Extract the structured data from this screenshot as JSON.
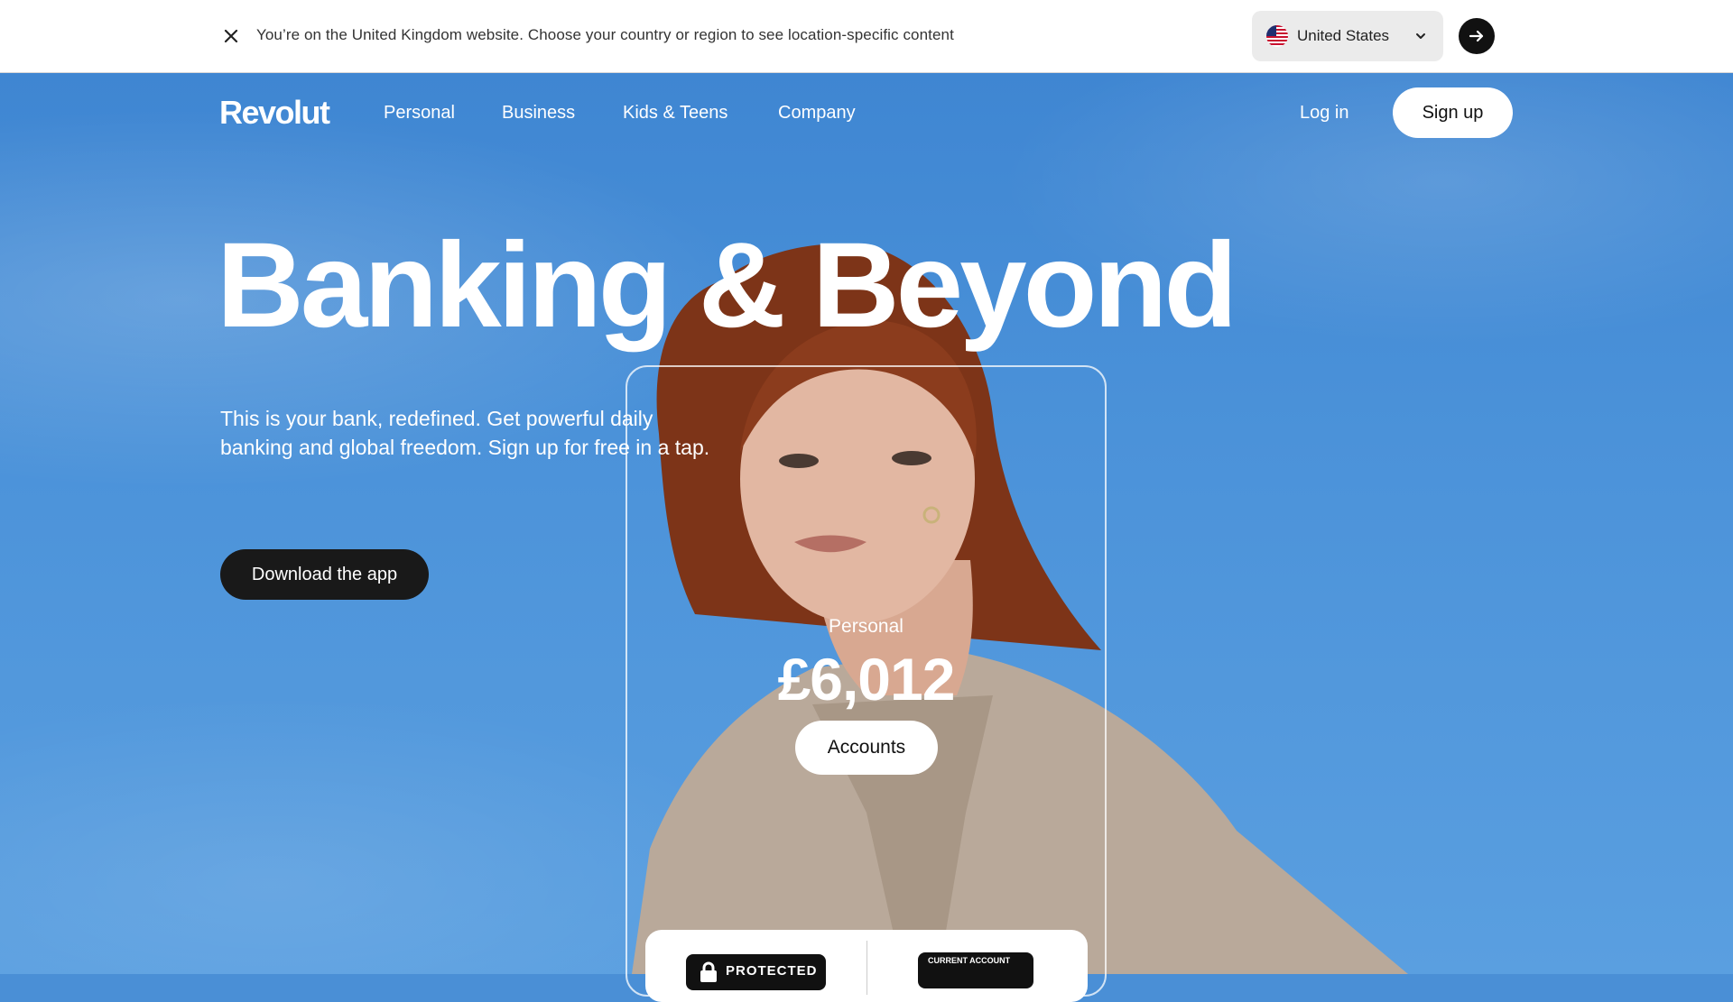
{
  "banner": {
    "message": "You’re on the United Kingdom website. Choose your country or region to see location-specific content",
    "country": "United States",
    "close_icon": "close-icon",
    "go_icon": "arrow-right-icon"
  },
  "nav": {
    "logo": "Revolut",
    "items": [
      "Personal",
      "Business",
      "Kids & Teens",
      "Company"
    ],
    "login": "Log in",
    "signup": "Sign up"
  },
  "hero": {
    "headline": "Banking & Beyond",
    "subtitle": "This is your bank, redefined. Get powerful daily banking and global freedom. Sign up for free in a tap.",
    "cta": "Download the app"
  },
  "card": {
    "label": "Personal",
    "balance": "£6,012",
    "button": "Accounts"
  },
  "badges": {
    "left": "PROTECTED",
    "right": "CURRENT ACCOUNT"
  },
  "colors": {
    "sky": "#4b92d9",
    "dark_button": "#191919",
    "white": "#ffffff"
  }
}
